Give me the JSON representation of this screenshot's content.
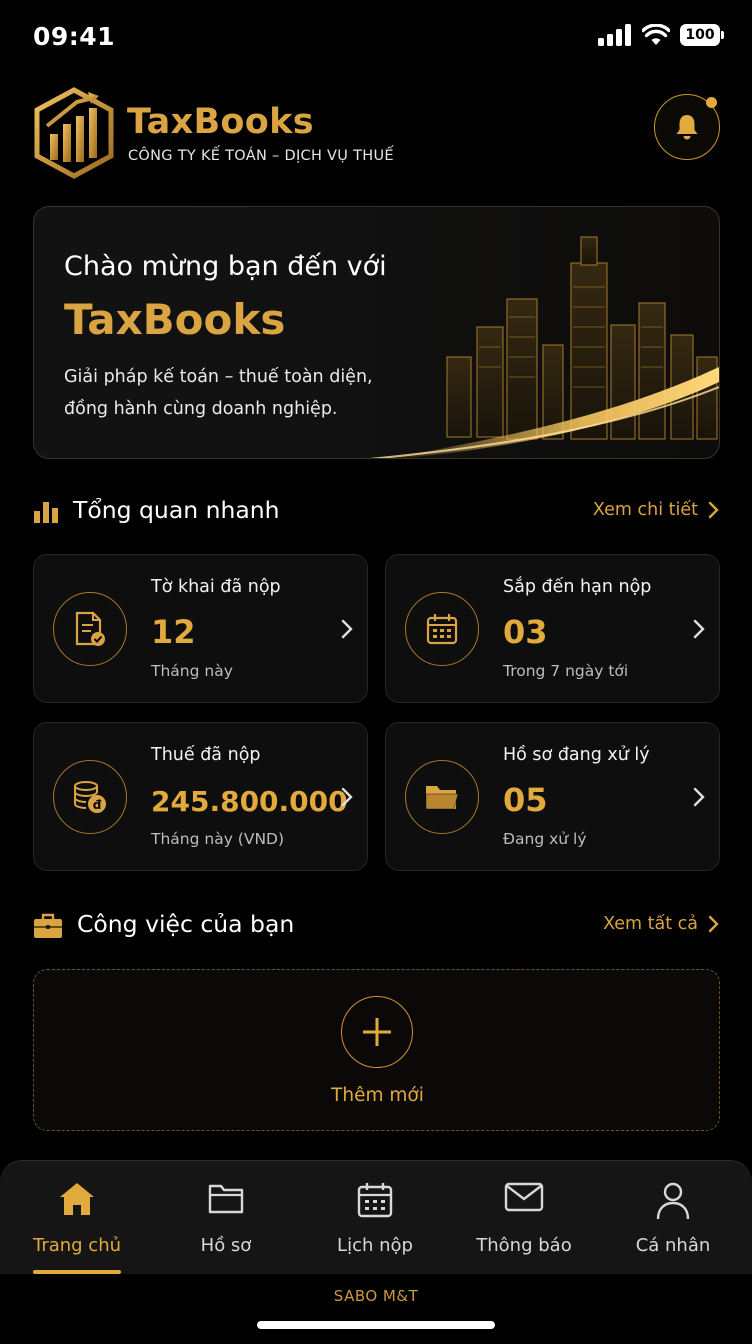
{
  "status_bar": {
    "time": "09:41",
    "battery": "100"
  },
  "header": {
    "brand_name": "TaxBooks",
    "brand_subtitle": "CÔNG TY KẾ TOÁN – DỊCH VỤ THUẾ"
  },
  "banner": {
    "title": "Chào mừng bạn đến với",
    "brand": "TaxBooks",
    "description": "Giải pháp kế toán – thuế toàn diện, đồng hành cùng doanh nghiệp."
  },
  "overview": {
    "title": "Tổng quan nhanh",
    "link": "Xem chi tiết",
    "cards": [
      {
        "label": "Tờ khai đã nộp",
        "value": "12",
        "sub": "Tháng này",
        "icon": "document-check-icon"
      },
      {
        "label": "Sắp đến hạn nộp",
        "value": "03",
        "sub": "Trong 7 ngày tới",
        "icon": "calendar-icon"
      },
      {
        "label": "Thuế đã nộp",
        "value": "245.800.000",
        "sub": "Tháng này (VND)",
        "icon": "coins-icon"
      },
      {
        "label": "Hồ sơ đang xử lý",
        "value": "05",
        "sub": "Đang xử lý",
        "icon": "folder-icon"
      }
    ]
  },
  "tasks": {
    "title": "Công việc của bạn",
    "link": "Xem tất cả",
    "add_label": "Thêm mới"
  },
  "nav": {
    "items": [
      {
        "label": "Trang chủ",
        "icon": "home-icon",
        "active": true
      },
      {
        "label": "Hồ sơ",
        "icon": "folder-icon"
      },
      {
        "label": "Lịch nộp",
        "icon": "calendar-icon"
      },
      {
        "label": "Thông báo",
        "icon": "mail-icon"
      },
      {
        "label": "Cá nhân",
        "icon": "user-icon"
      }
    ]
  },
  "footer": {
    "brand": "SABO M&T"
  },
  "colors": {
    "accent": "#e2a93c",
    "background": "#000000",
    "card": "#0e0e0e"
  }
}
